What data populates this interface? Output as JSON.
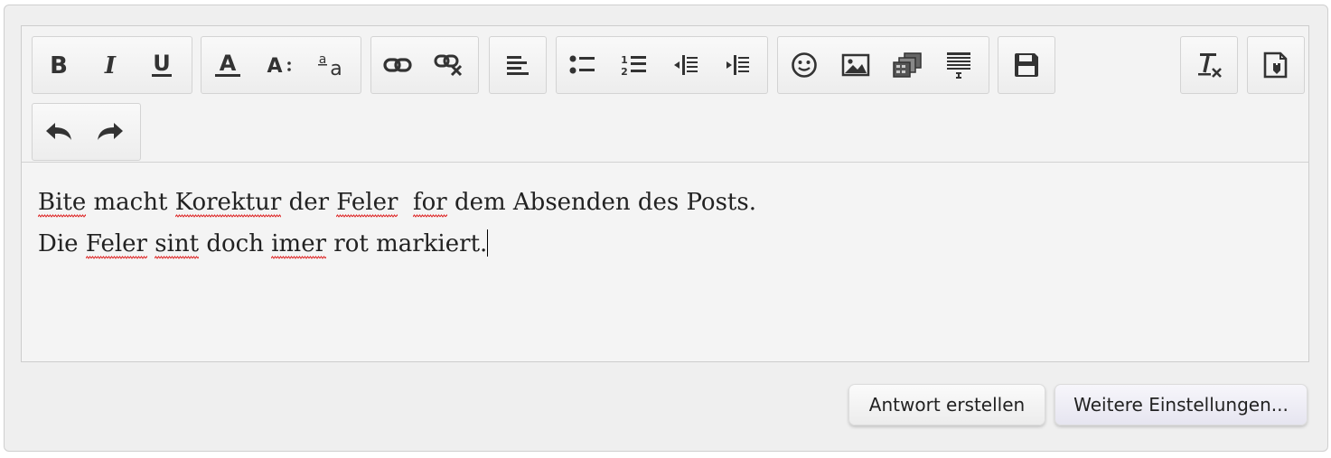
{
  "toolbar": {
    "groups": [
      {
        "name": "text-style",
        "buttons": [
          "bold",
          "italic",
          "underline"
        ]
      },
      {
        "name": "text-size",
        "buttons": [
          "font-color",
          "font-size",
          "subscript-style"
        ]
      },
      {
        "name": "links",
        "buttons": [
          "link",
          "unlink"
        ]
      },
      {
        "name": "align",
        "buttons": [
          "align-left"
        ]
      },
      {
        "name": "lists",
        "buttons": [
          "bulleted-list",
          "numbered-list",
          "outdent",
          "indent"
        ]
      },
      {
        "name": "insert",
        "buttons": [
          "emoticon",
          "image",
          "gallery",
          "quote-block"
        ]
      },
      {
        "name": "save",
        "buttons": [
          "save"
        ]
      },
      {
        "name": "clear",
        "buttons": [
          "remove-format"
        ]
      },
      {
        "name": "source",
        "buttons": [
          "source-toggle"
        ]
      },
      {
        "name": "history",
        "buttons": [
          "undo",
          "redo"
        ]
      }
    ]
  },
  "editor": {
    "lines": [
      "Bite macht Korektur der Feler  for dem Absenden des Posts.",
      "Die Feler sint doch imer rot markiert."
    ],
    "misspelled_words": [
      "Bite",
      "Korektur",
      "Feler",
      "for",
      "sint",
      "imer"
    ],
    "spellcheck_color": "#dd2222"
  },
  "actions": {
    "reply_label": "Antwort erstellen",
    "more_settings_label": "Weitere Einstellungen..."
  }
}
